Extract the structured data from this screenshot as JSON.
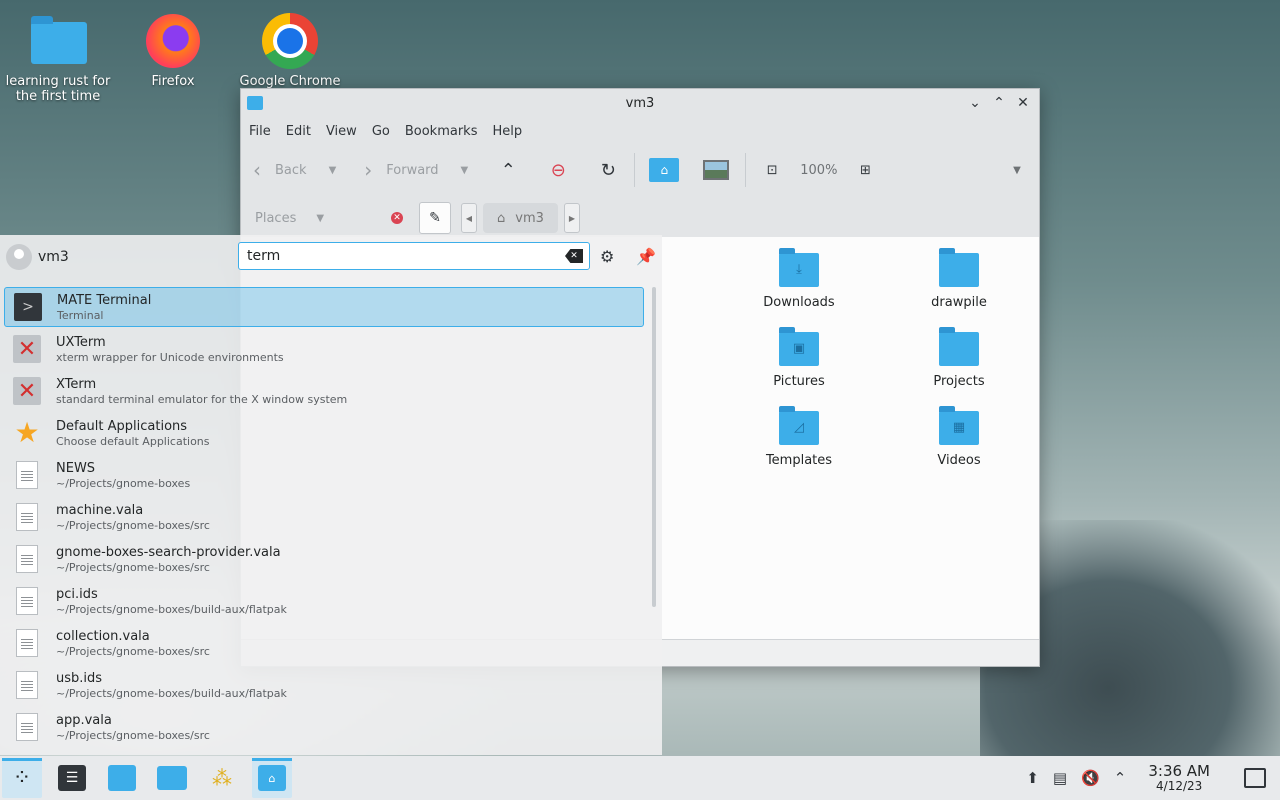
{
  "desktop": {
    "icons": [
      {
        "label": "learning rust for the first time",
        "icon": "folder-icon"
      },
      {
        "label": "Firefox",
        "icon": "firefox-icon"
      },
      {
        "label": "Google Chrome",
        "icon": "chrome-icon"
      }
    ]
  },
  "window": {
    "title": "vm3",
    "menu": [
      "File",
      "Edit",
      "View",
      "Go",
      "Bookmarks",
      "Help"
    ],
    "toolbar": {
      "back": "Back",
      "forward": "Forward",
      "zoom": "100%"
    },
    "places_label": "Places",
    "breadcrumb": "vm3",
    "items": [
      {
        "label": "Downloads",
        "glyph": "⤓"
      },
      {
        "label": "drawpile",
        "glyph": ""
      },
      {
        "label": "Pictures",
        "glyph": "▣"
      },
      {
        "label": "Projects",
        "glyph": ""
      },
      {
        "label": "Templates",
        "glyph": "◿"
      },
      {
        "label": "Videos",
        "glyph": "▦"
      }
    ]
  },
  "launcher": {
    "user": "vm3",
    "query": "term",
    "results": [
      {
        "title": "MATE Terminal",
        "subtitle": "Terminal",
        "icon": "terminal-icon",
        "selected": true
      },
      {
        "title": "UXTerm",
        "subtitle": "xterm wrapper for Unicode environments",
        "icon": "xterm-icon"
      },
      {
        "title": "XTerm",
        "subtitle": "standard terminal emulator for the X window system",
        "icon": "xterm-icon"
      },
      {
        "title": "Default Applications",
        "subtitle": "Choose default Applications",
        "icon": "star-icon"
      },
      {
        "title": "NEWS",
        "subtitle": "~/Projects/gnome-boxes",
        "icon": "document-icon"
      },
      {
        "title": "machine.vala",
        "subtitle": "~/Projects/gnome-boxes/src",
        "icon": "document-icon"
      },
      {
        "title": "gnome-boxes-search-provider.vala",
        "subtitle": "~/Projects/gnome-boxes/src",
        "icon": "document-icon"
      },
      {
        "title": "pci.ids",
        "subtitle": "~/Projects/gnome-boxes/build-aux/flatpak",
        "icon": "document-icon"
      },
      {
        "title": "collection.vala",
        "subtitle": "~/Projects/gnome-boxes/src",
        "icon": "document-icon"
      },
      {
        "title": "usb.ids",
        "subtitle": "~/Projects/gnome-boxes/build-aux/flatpak",
        "icon": "document-icon"
      },
      {
        "title": "app.vala",
        "subtitle": "~/Projects/gnome-boxes/src",
        "icon": "document-icon"
      }
    ]
  },
  "taskbar": {
    "time": "3:36 AM",
    "date": "4/12/23"
  },
  "colors": {
    "accent": "#3daee9",
    "folder": "#3daee9",
    "error": "#da4453"
  }
}
